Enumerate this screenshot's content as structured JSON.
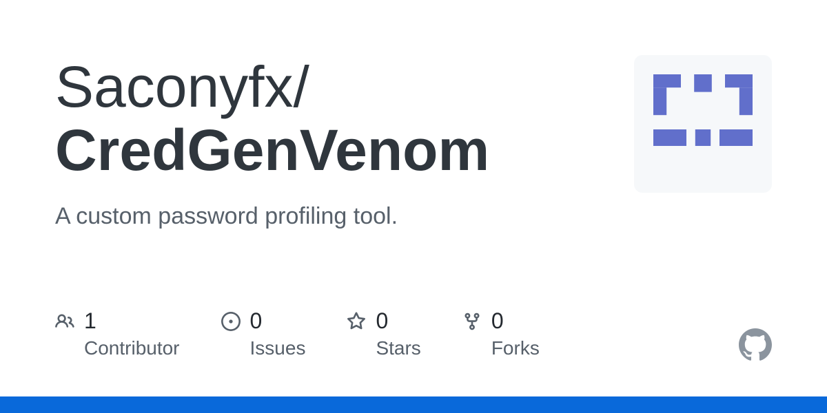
{
  "repo": {
    "owner": "Saconyfx/",
    "name": "CredGenVenom",
    "description": "A custom password profiling tool."
  },
  "stats": {
    "contributors": {
      "count": "1",
      "label": "Contributor"
    },
    "issues": {
      "count": "0",
      "label": "Issues"
    },
    "stars": {
      "count": "0",
      "label": "Stars"
    },
    "forks": {
      "count": "0",
      "label": "Forks"
    }
  },
  "colors": {
    "accent": "#0969da",
    "avatar_icon": "#616fcb"
  }
}
